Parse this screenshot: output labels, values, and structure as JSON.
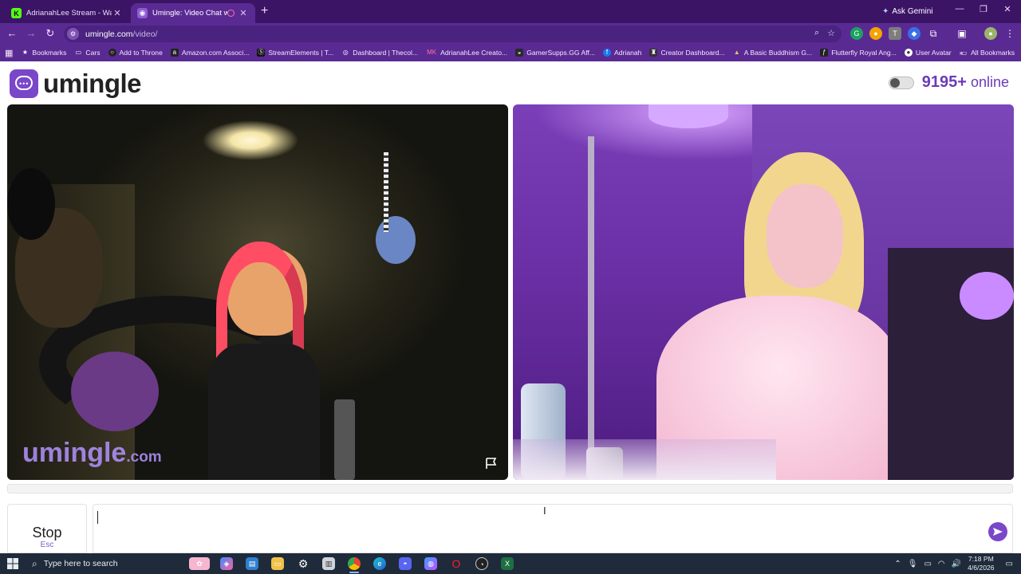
{
  "browser": {
    "tabs": [
      {
        "title": "AdrianahLee Stream - Watch Li",
        "favicon": "K",
        "favicon_color": "#53fc18"
      },
      {
        "title": "Umingle: Video Chat with S",
        "favicon": "U",
        "favicon_color": "#8e5bd6"
      }
    ],
    "new_tab": "+",
    "ask_gemini": "Ask Gemini",
    "url_host": "umingle.com",
    "url_path": "/video/",
    "bookmarks": [
      "Bookmarks",
      "Cars",
      "Add to Throne",
      "Amazon.com Associ...",
      "StreamElements | T...",
      "Dashboard | Thecol...",
      "AdrianahLee Creato...",
      "GamerSupps.GG Aff...",
      "Adrianah",
      "Creator Dashboard...",
      "A Basic Buddhism G...",
      "Flutterfly Royal Ang...",
      "User Avatar"
    ],
    "all_bookmarks": "All Bookmarks"
  },
  "site": {
    "logo_text": "umingle",
    "online_count": "9195+",
    "online_label": "online",
    "watermark_name": "umingle",
    "watermark_tld": ".com"
  },
  "controls": {
    "stop_label": "Stop",
    "stop_key": "Esc",
    "chat_value": ""
  },
  "taskbar": {
    "search_placeholder": "Type here to search",
    "time": "7:18 PM",
    "date": "4/6/2026"
  },
  "colors": {
    "brand_purple": "#7a47c9",
    "tab_strip": "#3b1466",
    "toolbar": "#5a2a93"
  }
}
